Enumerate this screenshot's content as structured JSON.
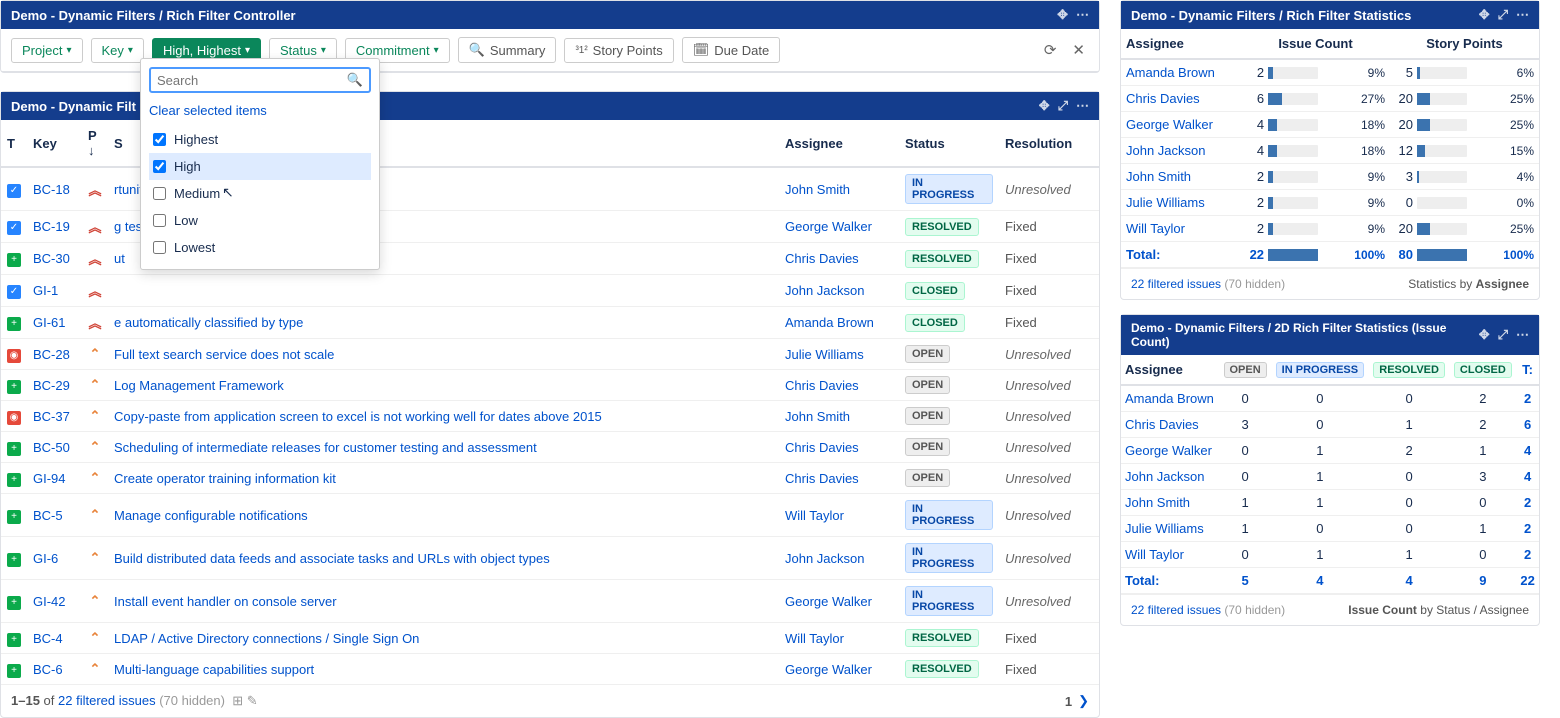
{
  "controller": {
    "title": "Demo - Dynamic Filters / Rich Filter Controller",
    "filters": {
      "project": "Project",
      "key": "Key",
      "priority": "High, Highest",
      "status": "Status",
      "commitment": "Commitment"
    },
    "tools": {
      "summary": "Summary",
      "storypoints": "Story Points",
      "duedate": "Due Date"
    },
    "dropdown": {
      "placeholder": "Search",
      "clear": "Clear selected items",
      "options": [
        {
          "label": "Highest",
          "checked": true,
          "selected": false
        },
        {
          "label": "High",
          "checked": true,
          "selected": true
        },
        {
          "label": "Medium",
          "checked": false,
          "selected": false
        },
        {
          "label": "Low",
          "checked": false,
          "selected": false
        },
        {
          "label": "Lowest",
          "checked": false,
          "selected": false
        }
      ]
    }
  },
  "results": {
    "title": "Demo - Dynamic Filt",
    "columns": {
      "t": "T",
      "key": "Key",
      "p": "P",
      "s": "S",
      "assignee": "Assignee",
      "status": "Status",
      "resolution": "Resolution"
    },
    "rows": [
      {
        "type": "task",
        "key": "BC-18",
        "prio": "highest",
        "summary": "rtunity for knowledge transfer.",
        "assignee": "John Smith",
        "status": "IN PROGRESS",
        "statusClass": "progress",
        "resolution": "Unresolved"
      },
      {
        "type": "task",
        "key": "BC-19",
        "prio": "highest",
        "summary": "g test cases, expected and achieved results",
        "assignee": "George Walker",
        "status": "RESOLVED",
        "statusClass": "resolved",
        "resolution": "Fixed"
      },
      {
        "type": "story",
        "key": "BC-30",
        "prio": "highest",
        "summary": "ut",
        "assignee": "Chris Davies",
        "status": "RESOLVED",
        "statusClass": "resolved",
        "resolution": "Fixed"
      },
      {
        "type": "task",
        "key": "GI-1",
        "prio": "highest",
        "summary": "",
        "assignee": "John Jackson",
        "status": "CLOSED",
        "statusClass": "closed",
        "resolution": "Fixed"
      },
      {
        "type": "story",
        "key": "GI-61",
        "prio": "highest",
        "summary": "e automatically classified by type",
        "assignee": "Amanda Brown",
        "status": "CLOSED",
        "statusClass": "closed",
        "resolution": "Fixed"
      },
      {
        "type": "bug",
        "key": "BC-28",
        "prio": "high",
        "summary": "Full text search service does not scale",
        "assignee": "Julie Williams",
        "status": "OPEN",
        "statusClass": "open",
        "resolution": "Unresolved"
      },
      {
        "type": "story",
        "key": "BC-29",
        "prio": "high",
        "summary": "Log Management Framework",
        "assignee": "Chris Davies",
        "status": "OPEN",
        "statusClass": "open",
        "resolution": "Unresolved"
      },
      {
        "type": "bug",
        "key": "BC-37",
        "prio": "high",
        "summary": "Copy-paste from application screen to excel is not working well for dates above 2015",
        "assignee": "John Smith",
        "status": "OPEN",
        "statusClass": "open",
        "resolution": "Unresolved"
      },
      {
        "type": "story",
        "key": "BC-50",
        "prio": "high",
        "summary": "Scheduling of intermediate releases for customer testing and assessment",
        "assignee": "Chris Davies",
        "status": "OPEN",
        "statusClass": "open",
        "resolution": "Unresolved"
      },
      {
        "type": "story",
        "key": "GI-94",
        "prio": "high",
        "summary": "Create operator training information kit",
        "assignee": "Chris Davies",
        "status": "OPEN",
        "statusClass": "open",
        "resolution": "Unresolved"
      },
      {
        "type": "story",
        "key": "BC-5",
        "prio": "high",
        "summary": "Manage configurable notifications",
        "assignee": "Will Taylor",
        "status": "IN PROGRESS",
        "statusClass": "progress",
        "resolution": "Unresolved"
      },
      {
        "type": "story",
        "key": "GI-6",
        "prio": "high",
        "summary": "Build distributed data feeds and associate tasks and URLs with object types",
        "assignee": "John Jackson",
        "status": "IN PROGRESS",
        "statusClass": "progress",
        "resolution": "Unresolved"
      },
      {
        "type": "story",
        "key": "GI-42",
        "prio": "high",
        "summary": "Install event handler on console server",
        "assignee": "George Walker",
        "status": "IN PROGRESS",
        "statusClass": "progress",
        "resolution": "Unresolved"
      },
      {
        "type": "story",
        "key": "BC-4",
        "prio": "high",
        "summary": "LDAP / Active Directory connections / Single Sign On",
        "assignee": "Will Taylor",
        "status": "RESOLVED",
        "statusClass": "resolved",
        "resolution": "Fixed"
      },
      {
        "type": "story",
        "key": "BC-6",
        "prio": "high",
        "summary": "Multi-language capabilities support",
        "assignee": "George Walker",
        "status": "RESOLVED",
        "statusClass": "resolved",
        "resolution": "Fixed"
      }
    ],
    "footer": {
      "range": "1–15",
      "of": "of",
      "filtered": "22 filtered issues",
      "hidden": "(70 hidden)",
      "page": "1",
      "next": "❯"
    }
  },
  "stats": {
    "title": "Demo - Dynamic Filters / Rich Filter Statistics",
    "cols": {
      "assignee": "Assignee",
      "count": "Issue Count",
      "points": "Story Points"
    },
    "rows": [
      {
        "name": "Amanda Brown",
        "count": 2,
        "countPct": "9%",
        "points": 5,
        "pointsPct": "6%"
      },
      {
        "name": "Chris Davies",
        "count": 6,
        "countPct": "27%",
        "points": 20,
        "pointsPct": "25%"
      },
      {
        "name": "George Walker",
        "count": 4,
        "countPct": "18%",
        "points": 20,
        "pointsPct": "25%"
      },
      {
        "name": "John Jackson",
        "count": 4,
        "countPct": "18%",
        "points": 12,
        "pointsPct": "15%"
      },
      {
        "name": "John Smith",
        "count": 2,
        "countPct": "9%",
        "points": 3,
        "pointsPct": "4%"
      },
      {
        "name": "Julie Williams",
        "count": 2,
        "countPct": "9%",
        "points": 0,
        "pointsPct": "0%"
      },
      {
        "name": "Will Taylor",
        "count": 2,
        "countPct": "9%",
        "points": 20,
        "pointsPct": "25%"
      }
    ],
    "total": {
      "label": "Total:",
      "count": 22,
      "countPct": "100%",
      "points": 80,
      "pointsPct": "100%"
    },
    "footer": {
      "filtered": "22 filtered issues",
      "hidden": "(70 hidden)",
      "by": "Statistics by",
      "field": "Assignee"
    }
  },
  "stats2d": {
    "title": "Demo - Dynamic Filters / 2D Rich Filter Statistics (Issue Count)",
    "cols": {
      "assignee": "Assignee",
      "open": "OPEN",
      "progress": "IN PROGRESS",
      "resolved": "RESOLVED",
      "closed": "CLOSED",
      "total": "T:"
    },
    "rows": [
      {
        "name": "Amanda Brown",
        "v": [
          0,
          0,
          0,
          2,
          2
        ]
      },
      {
        "name": "Chris Davies",
        "v": [
          3,
          0,
          1,
          2,
          6
        ]
      },
      {
        "name": "George Walker",
        "v": [
          0,
          1,
          2,
          1,
          4
        ]
      },
      {
        "name": "John Jackson",
        "v": [
          0,
          1,
          0,
          3,
          4
        ]
      },
      {
        "name": "John Smith",
        "v": [
          1,
          1,
          0,
          0,
          2
        ]
      },
      {
        "name": "Julie Williams",
        "v": [
          1,
          0,
          0,
          1,
          2
        ]
      },
      {
        "name": "Will Taylor",
        "v": [
          0,
          1,
          1,
          0,
          2
        ]
      }
    ],
    "total": {
      "label": "Total:",
      "v": [
        5,
        4,
        4,
        9,
        22
      ]
    },
    "footer": {
      "filtered": "22 filtered issues",
      "hidden": "(70 hidden)",
      "by": "Issue Count",
      "byRest": "by Status / Assignee"
    }
  }
}
